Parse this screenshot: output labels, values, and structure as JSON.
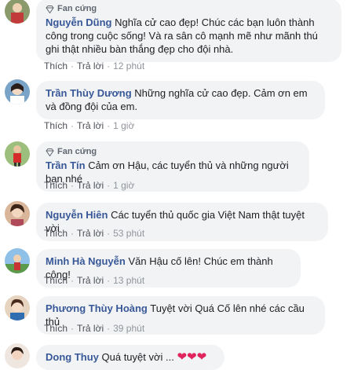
{
  "labels": {
    "like": "Thích",
    "reply": "Trả lời",
    "sep": "·",
    "fan_badge": "Fan cứng"
  },
  "colors": {
    "author": "#385898",
    "bubble": "#f2f3f5",
    "meta": "#90949c",
    "heart": "#e0245e"
  },
  "comments": [
    {
      "author": "Nguyễn Dũng",
      "badge": "Fan cứng",
      "text": "Nghĩa cử cao đẹp! Chúc các bạn luôn thành công trong cuộc sống! Và ra sân cô mạnh mẽ như mãnh thú ghi thật nhiều bàn thắng đẹp cho đội nhà.",
      "time": "12 phút"
    },
    {
      "author": "Trần Thùy Dương",
      "text": "Những nghĩa cử cao đẹp. Cảm ơn em và đồng đội của em.",
      "time": "1 giờ"
    },
    {
      "author": "Trần Tín",
      "badge": "Fan cứng",
      "text": "Cảm ơn Hậu, các tuyển thủ và những người bạn nhé",
      "time": "1 giờ"
    },
    {
      "author": "Nguyễn Hiên",
      "text": "Các tuyển thủ quốc gia Việt Nam thật tuyệt vời",
      "time": "53 phút"
    },
    {
      "author": "Minh Hà Nguyễn",
      "text": "Văn Hậu cố lên! Chúc em thành công!",
      "time": "13 phút"
    },
    {
      "author": "Phương Thùy Hoàng",
      "text": "Tuyệt vời Quá Cố lên nhé các cầu thủ",
      "time": "39 phút"
    },
    {
      "author": "Dong Thuy",
      "text": "Quá tuyệt vời ...",
      "hearts": "❤❤❤"
    }
  ]
}
